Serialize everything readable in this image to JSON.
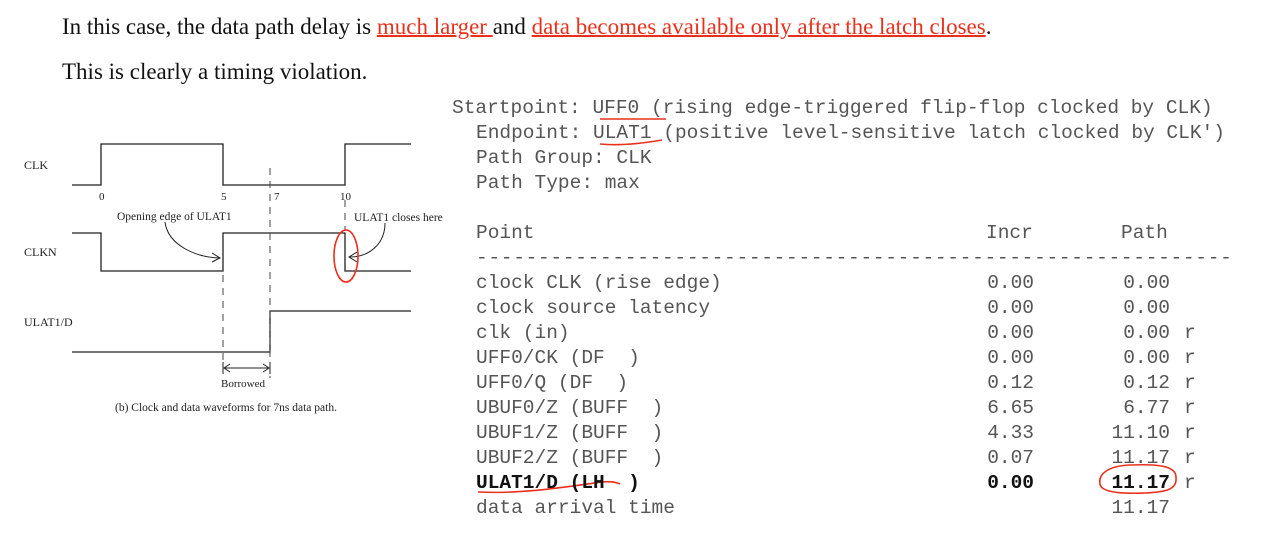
{
  "heading": {
    "line1_before": "In this case, the data path delay is ",
    "line1_hl1": "much larger ",
    "line1_mid": "and ",
    "line1_hl2": "data becomes available only after the latch closes",
    "line1_end": ".",
    "line2": "This is clearly a timing violation."
  },
  "diagram": {
    "labels": {
      "clk": "CLK",
      "clkn": "CLKN",
      "ulat1d": "ULAT1/D",
      "t0": "0",
      "t5": "5",
      "t7": "7",
      "t10": "10",
      "opening_edge": "Opening edge of ULAT1",
      "closes_here": "ULAT1 closes here",
      "borrowed": "Borrowed",
      "caption": "(b) Clock and data waveforms for 7ns data path."
    },
    "colors": {
      "annotation": "#e8301c",
      "waveform": "#222222"
    }
  },
  "report": {
    "startpoint_label": "Startpoint:",
    "startpoint_value": "UFF0",
    "startpoint_desc": "(rising edge-triggered flip-flop clocked by CLK)",
    "endpoint_label": "Endpoint:",
    "endpoint_value": "ULAT1",
    "endpoint_desc": "(positive level-sensitive latch clocked by CLK')",
    "path_group": "Path Group: CLK",
    "path_type": "Path Type: max",
    "col_point": "Point",
    "col_incr": "Incr",
    "col_path": "Path",
    "separator": "-------------------------------------------------------------",
    "rows": [
      {
        "point": "clock CLK (rise edge)",
        "incr": "0.00",
        "path": "0.00",
        "flag": ""
      },
      {
        "point": "clock source latency",
        "incr": "0.00",
        "path": "0.00",
        "flag": ""
      },
      {
        "point": "clk (in)",
        "incr": "0.00",
        "path": "0.00",
        "flag": "r"
      },
      {
        "point": "UFF0/CK (DF  )",
        "incr": "0.00",
        "path": "0.00",
        "flag": "r"
      },
      {
        "point": "UFF0/Q (DF  )",
        "incr": "0.12",
        "path": "0.12",
        "flag": "r"
      },
      {
        "point": "UBUF0/Z (BUFF  )",
        "incr": "6.65",
        "path": "6.77",
        "flag": "r"
      },
      {
        "point": "UBUF1/Z (BUFF  )",
        "incr": "4.33",
        "path": "11.10",
        "flag": "r"
      },
      {
        "point": "UBUF2/Z (BUFF  )",
        "incr": "0.07",
        "path": "11.17",
        "flag": "r"
      },
      {
        "point": "ULAT1/D (LH  )",
        "incr": "0.00",
        "path": "11.17",
        "flag": "r"
      },
      {
        "point": "data arrival time",
        "incr": "",
        "path": "11.17",
        "flag": ""
      }
    ]
  }
}
